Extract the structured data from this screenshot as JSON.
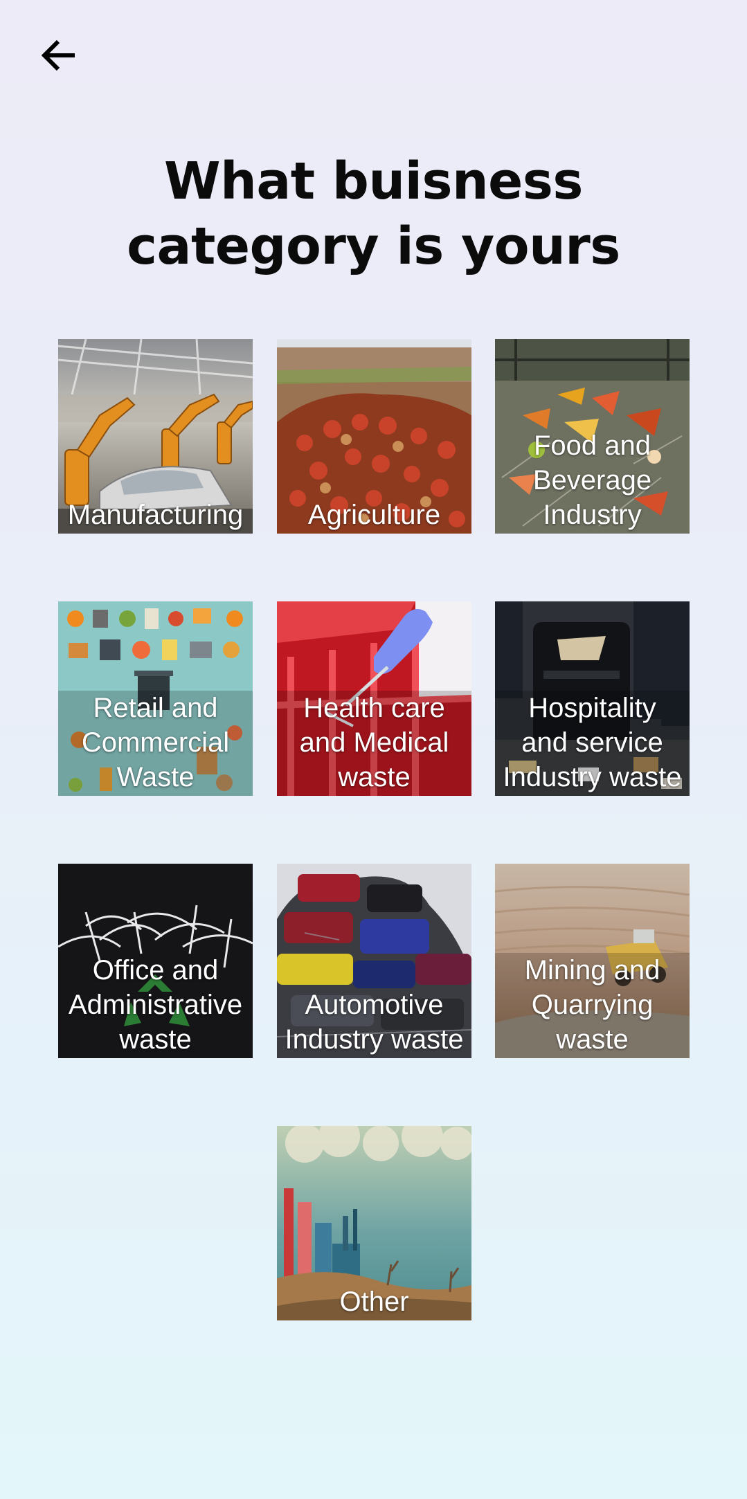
{
  "header": {
    "back_icon": "arrow-left-icon",
    "title": "What buisness\ncategory is yours"
  },
  "categories": [
    {
      "label": "Manufacturing",
      "image": "robot-assembly-line"
    },
    {
      "label": "Agriculture",
      "image": "produce-waste-pile"
    },
    {
      "label": "Food and\nBeverage\nIndustry",
      "image": "compost-bin"
    },
    {
      "label": "Retail and\nCommercial\nWaste",
      "image": "retail-items-flatlay"
    },
    {
      "label": "Health care\nand Medical\nwaste",
      "image": "medical-waste-glove"
    },
    {
      "label": "Hospitality\nand service\nIndustry waste",
      "image": "street-litter-bin"
    },
    {
      "label": "Office and\nAdministrative\nwaste",
      "image": "shredded-paper-recycle"
    },
    {
      "label": "Automotive\nIndustry waste",
      "image": "scrap-cars"
    },
    {
      "label": "Mining and\nQuarrying\nwaste",
      "image": "open-pit-mine-truck"
    },
    {
      "label": "Other",
      "image": "polluted-factory-illustration"
    }
  ],
  "colors": {
    "background_top": "#ecebf7",
    "background_bottom": "#e3f6fa",
    "title": "#0b0b0b",
    "label": "#ffffff"
  }
}
